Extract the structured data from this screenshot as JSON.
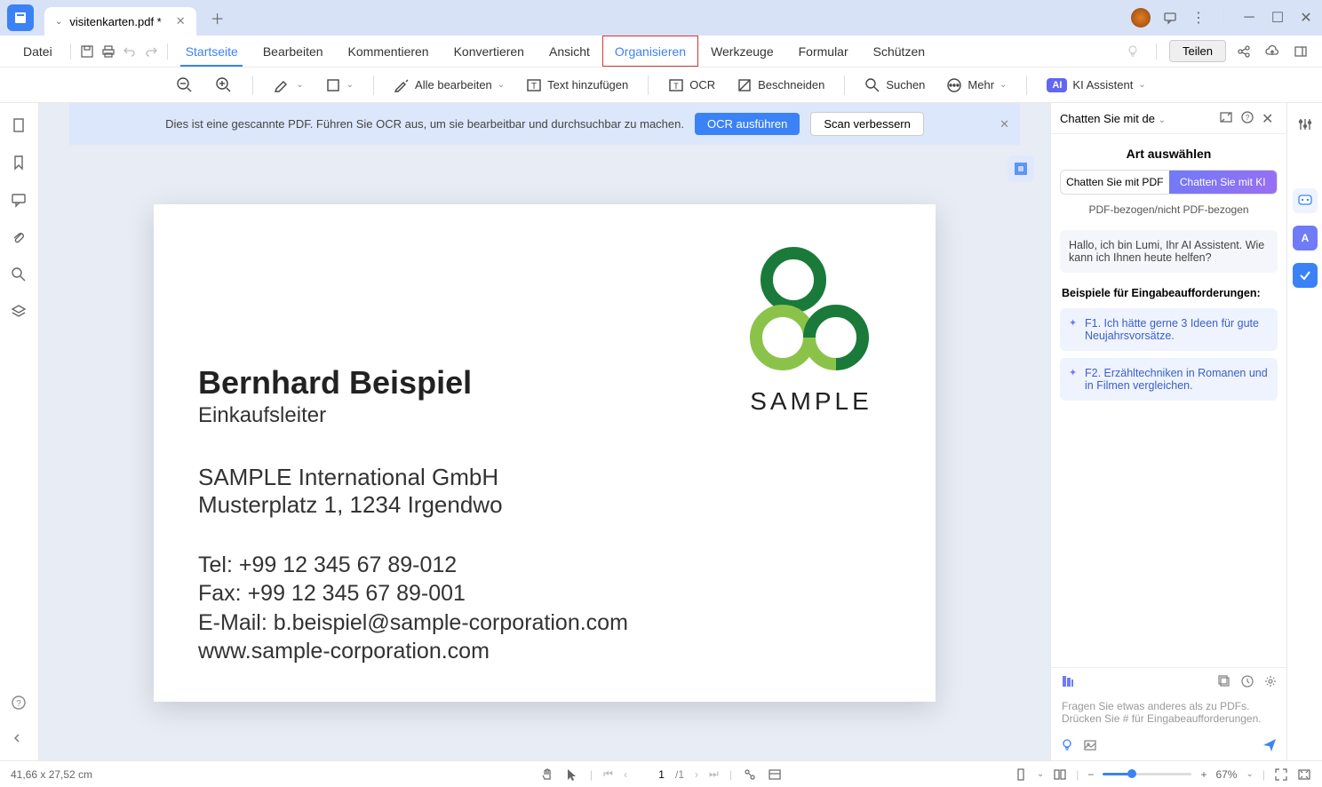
{
  "tab": {
    "title": "visitenkarten.pdf *"
  },
  "menu": {
    "file": "Datei",
    "items": [
      "Startseite",
      "Bearbeiten",
      "Kommentieren",
      "Konvertieren",
      "Ansicht",
      "Organisieren",
      "Werkzeuge",
      "Formular",
      "Schützen"
    ],
    "active_index": 0,
    "highlighted_index": 5,
    "share": "Teilen"
  },
  "toolbar": {
    "edit_all": "Alle bearbeiten",
    "add_text": "Text hinzufügen",
    "ocr": "OCR",
    "crop": "Beschneiden",
    "search": "Suchen",
    "more": "Mehr",
    "ai_badge": "AI",
    "ai_assistant": "KI Assistent"
  },
  "banner": {
    "text": "Dies ist eine gescannte PDF. Führen Sie OCR aus, um sie bearbeitbar und durchsuchbar zu machen.",
    "primary": "OCR ausführen",
    "secondary": "Scan verbessern"
  },
  "card": {
    "name": "Bernhard Beispiel",
    "role": "Einkaufsleiter",
    "company": "SAMPLE International GmbH",
    "address": "Musterplatz 1, 1234 Irgendwo",
    "tel": "Tel: +99 12 345 67 89-012",
    "fax": "Fax:  +99 12 345 67 89-001",
    "email": "E-Mail: b.beispiel@sample-corporation.com",
    "web": "www.sample-corporation.com",
    "logo_text": "SAMPLE"
  },
  "ai": {
    "dropdown": "Chatten Sie mit de",
    "subtitle": "Art auswählen",
    "toggle_pdf": "Chatten Sie mit PDF",
    "toggle_ki": "Chatten Sie mit KI",
    "note": "PDF-bezogen/nicht PDF-bezogen",
    "greeting": "Hallo, ich bin Lumi, Ihr AI Assistent. Wie kann ich Ihnen heute helfen?",
    "examples_title": "Beispiele für Eingabeaufforderungen:",
    "prompt1": "F1. Ich hätte gerne 3 Ideen für gute Neujahrsvorsätze.",
    "prompt2": "F2. Erzähltechniken in Romanen und in Filmen vergleichen.",
    "input_placeholder": "Fragen Sie etwas anderes als zu PDFs. Drücken Sie # für Eingabeaufforderungen."
  },
  "status": {
    "dimensions": "41,66 x 27,52 cm",
    "page_current": "1",
    "page_total": "/1",
    "zoom": "67%"
  }
}
